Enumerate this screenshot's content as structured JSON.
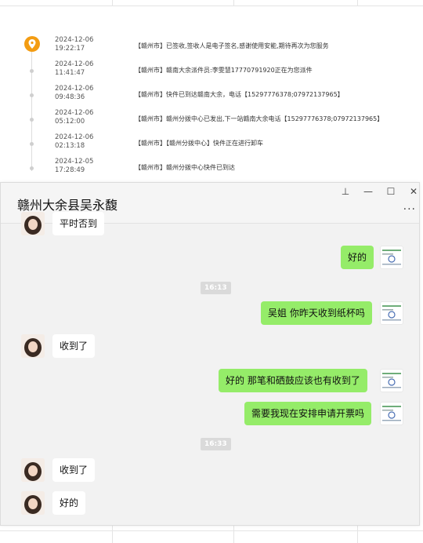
{
  "tracking": {
    "events": [
      {
        "date": "2024-12-06",
        "time": "19:22:17",
        "text": "【赣州市】已签收,签收人是电子签名,感谢使用安能,期待再次为您服务"
      },
      {
        "date": "2024-12-06",
        "time": "11:41:47",
        "text": "【赣州市】赣南大余派件员:李雯慧17770791920正在为您派件"
      },
      {
        "date": "2024-12-06",
        "time": "09:48:36",
        "text": "【赣州市】快件已到达赣南大余，电话【15297776378;07972137965】"
      },
      {
        "date": "2024-12-06",
        "time": "05:12:00",
        "text": "【赣州市】赣州分拨中心已发出,下一站赣南大余电话【15297776378;07972137965】"
      },
      {
        "date": "2024-12-06",
        "time": "02:13:18",
        "text": "【赣州市】【赣州分拨中心】快件正在进行卸车"
      },
      {
        "date": "2024-12-05",
        "time": "17:28:49",
        "text": "【赣州市】赣州分拨中心快件已到达"
      }
    ]
  },
  "chat": {
    "title": "赣州大余县吴永馥",
    "controls": {
      "pin": "⊥",
      "minimize": "—",
      "maximize": "☐",
      "close": "✕",
      "more": "···"
    },
    "partial_text": "平时否到",
    "messages": [
      {
        "side": "right",
        "text": "好的"
      },
      {
        "timestamp": "16:13"
      },
      {
        "side": "right",
        "text": "吴姐 你昨天收到纸杯吗"
      },
      {
        "side": "left",
        "text": "收到了"
      },
      {
        "side": "right",
        "text": "好的  那笔和硒鼓应该也有收到了"
      },
      {
        "side": "right",
        "text": "需要我现在安排申请开票吗"
      },
      {
        "timestamp": "16:33"
      },
      {
        "side": "left",
        "text": "收到了"
      },
      {
        "side": "left",
        "text": "好的"
      }
    ]
  },
  "colors": {
    "sent_bubble": "#95ec69",
    "pin_marker": "#f39c12",
    "chat_bg": "#f2f2f2"
  }
}
